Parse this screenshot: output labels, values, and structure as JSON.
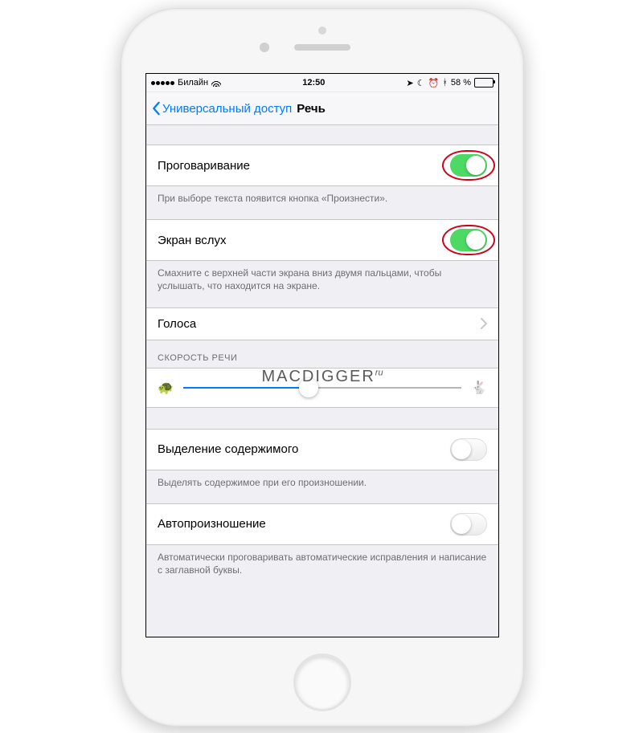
{
  "statusbar": {
    "carrier": "Билайн",
    "time": "12:50",
    "battery_pct": "58 %",
    "signal_filled": 5
  },
  "nav": {
    "back": "Универсальный доступ",
    "title": "Речь"
  },
  "rows": {
    "speak_selection": {
      "label": "Проговаривание",
      "on": true
    },
    "speak_selection_footer": "При выборе текста появится кнопка «Произнести».",
    "speak_screen": {
      "label": "Экран вслух",
      "on": true
    },
    "speak_screen_footer": "Смахните с верхней части экрана вниз двумя пальцами, чтобы услышать, что находится на экране.",
    "voices": {
      "label": "Голоса"
    },
    "rate_header": "СКОРОСТЬ РЕЧИ",
    "rate_value_pct": 45,
    "highlight": {
      "label": "Выделение содержимого",
      "on": false
    },
    "highlight_footer": "Выделять содержимое при его произношении.",
    "autospeak": {
      "label": "Автопроизношение",
      "on": false
    },
    "autospeak_footer": "Автоматически проговаривать автоматические исправления и написание с заглавной буквы."
  },
  "watermark": {
    "main": "MACDIGGER",
    "sup": "ru"
  },
  "icons": {
    "turtle": "🐢",
    "rabbit": "🐇"
  }
}
